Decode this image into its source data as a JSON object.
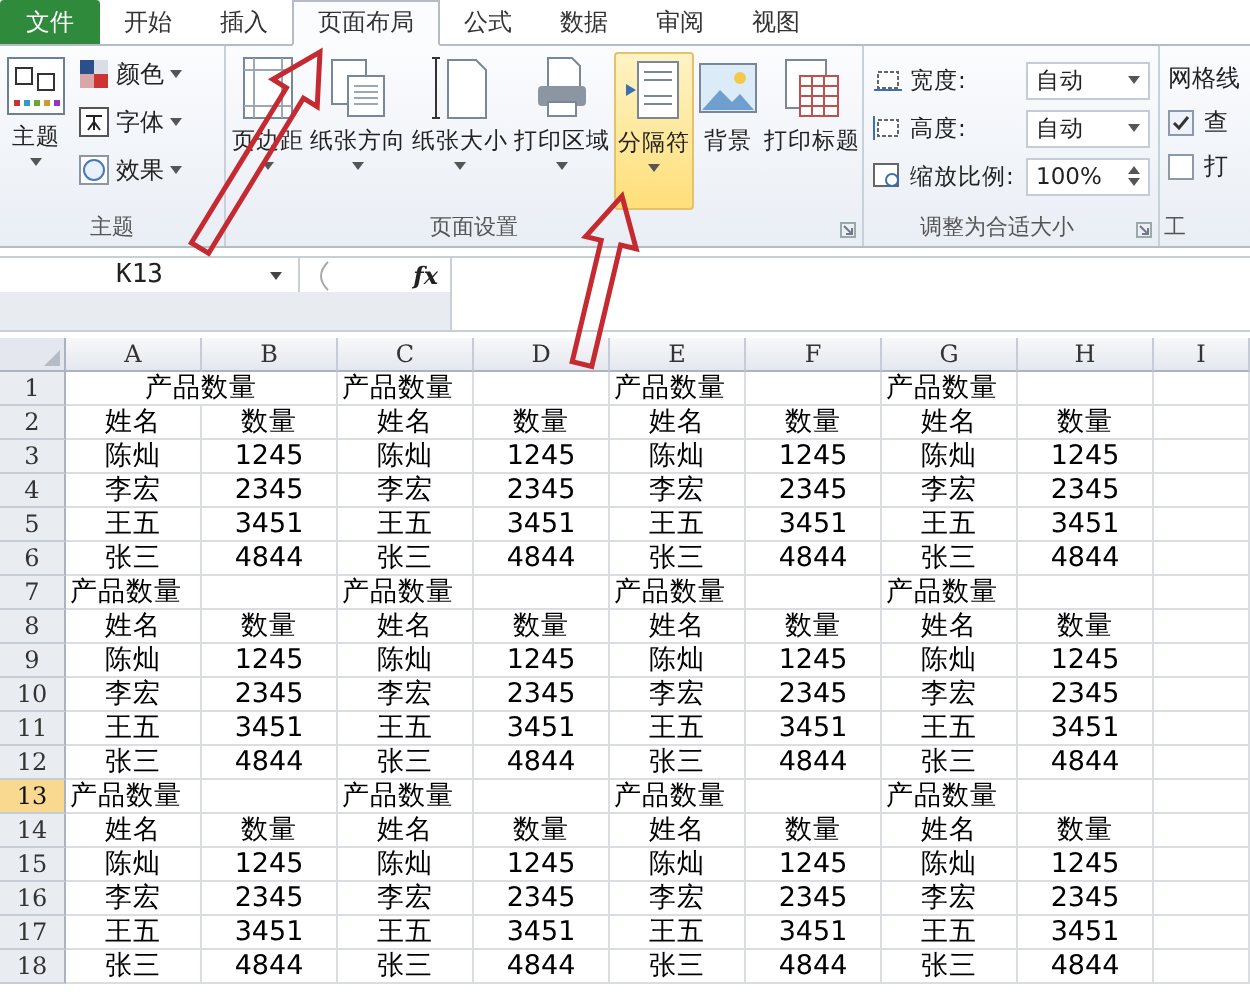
{
  "tabs": [
    {
      "label": "文件",
      "kind": "file",
      "selected": false
    },
    {
      "label": "开始",
      "kind": "tab",
      "selected": false
    },
    {
      "label": "插入",
      "kind": "tab",
      "selected": false
    },
    {
      "label": "页面布局",
      "kind": "tab",
      "selected": true
    },
    {
      "label": "公式",
      "kind": "tab",
      "selected": false
    },
    {
      "label": "数据",
      "kind": "tab",
      "selected": false
    },
    {
      "label": "审阅",
      "kind": "tab",
      "selected": false
    },
    {
      "label": "视图",
      "kind": "tab",
      "selected": false
    }
  ],
  "ribbon": {
    "groups": [
      {
        "kind": "theme",
        "label": "主题",
        "big": {
          "label": "主题"
        },
        "items": [
          {
            "label": "颜色"
          },
          {
            "label": "字体"
          },
          {
            "label": "效果"
          }
        ]
      },
      {
        "kind": "page-setup",
        "label": "页面设置",
        "buttons": [
          {
            "label": "页边距",
            "dropdown": true,
            "highlighted": false
          },
          {
            "label": "纸张方向",
            "dropdown": true,
            "highlighted": false
          },
          {
            "label": "纸张大小",
            "dropdown": true,
            "highlighted": false
          },
          {
            "label": "打印区域",
            "dropdown": true,
            "highlighted": false
          },
          {
            "label": "分隔符",
            "dropdown": true,
            "highlighted": true
          },
          {
            "label": "背景",
            "dropdown": false,
            "highlighted": false
          },
          {
            "label": "打印标题",
            "dropdown": false,
            "highlighted": false
          }
        ]
      },
      {
        "kind": "scale",
        "label": "调整为合适大小",
        "fields": [
          {
            "label": "宽度:",
            "value": "自动",
            "kind": "select"
          },
          {
            "label": "高度:",
            "value": "自动",
            "kind": "select"
          },
          {
            "label": "缩放比例:",
            "value": "100%",
            "kind": "spin"
          }
        ]
      },
      {
        "kind": "sheet-options",
        "label": "工",
        "title": "网格线",
        "options": [
          {
            "label": "查",
            "checked": true
          },
          {
            "label": "打",
            "checked": false
          }
        ]
      }
    ]
  },
  "formula_bar": {
    "name_box": "K13",
    "fx": "fx"
  },
  "sheet": {
    "columns": [
      "A",
      "B",
      "C",
      "D",
      "E",
      "F",
      "G",
      "H",
      "I"
    ],
    "rows": [
      {
        "num": "1",
        "selected": false,
        "cells": [
          {
            "kind": "merged-title",
            "text": "产品数量"
          },
          "",
          {
            "kind": "title",
            "text": "产品数量"
          },
          "",
          {
            "kind": "title",
            "text": "产品数量"
          },
          "",
          {
            "kind": "title",
            "text": "产品数量"
          },
          ""
        ]
      },
      {
        "num": "2",
        "selected": false,
        "cells": [
          {
            "kind": "value",
            "text": "姓名"
          },
          {
            "kind": "value",
            "text": "数量"
          },
          {
            "kind": "value",
            "text": "姓名"
          },
          {
            "kind": "value",
            "text": "数量"
          },
          {
            "kind": "value",
            "text": "姓名"
          },
          {
            "kind": "value",
            "text": "数量"
          },
          {
            "kind": "value",
            "text": "姓名"
          },
          {
            "kind": "value",
            "text": "数量"
          }
        ]
      },
      {
        "num": "3",
        "selected": false,
        "cells": [
          {
            "kind": "value",
            "text": "陈灿"
          },
          {
            "kind": "value",
            "text": "1245"
          },
          {
            "kind": "value",
            "text": "陈灿"
          },
          {
            "kind": "value",
            "text": "1245"
          },
          {
            "kind": "value",
            "text": "陈灿"
          },
          {
            "kind": "value",
            "text": "1245"
          },
          {
            "kind": "value",
            "text": "陈灿"
          },
          {
            "kind": "value",
            "text": "1245"
          }
        ]
      },
      {
        "num": "4",
        "selected": false,
        "cells": [
          {
            "kind": "value",
            "text": "李宏"
          },
          {
            "kind": "value",
            "text": "2345"
          },
          {
            "kind": "value",
            "text": "李宏"
          },
          {
            "kind": "value",
            "text": "2345"
          },
          {
            "kind": "value",
            "text": "李宏"
          },
          {
            "kind": "value",
            "text": "2345"
          },
          {
            "kind": "value",
            "text": "李宏"
          },
          {
            "kind": "value",
            "text": "2345"
          }
        ]
      },
      {
        "num": "5",
        "selected": false,
        "cells": [
          {
            "kind": "value",
            "text": "王五"
          },
          {
            "kind": "value",
            "text": "3451"
          },
          {
            "kind": "value",
            "text": "王五"
          },
          {
            "kind": "value",
            "text": "3451"
          },
          {
            "kind": "value",
            "text": "王五"
          },
          {
            "kind": "value",
            "text": "3451"
          },
          {
            "kind": "value",
            "text": "王五"
          },
          {
            "kind": "value",
            "text": "3451"
          }
        ]
      },
      {
        "num": "6",
        "selected": false,
        "cells": [
          {
            "kind": "value",
            "text": "张三"
          },
          {
            "kind": "value",
            "text": "4844"
          },
          {
            "kind": "value",
            "text": "张三"
          },
          {
            "kind": "value",
            "text": "4844"
          },
          {
            "kind": "value",
            "text": "张三"
          },
          {
            "kind": "value",
            "text": "4844"
          },
          {
            "kind": "value",
            "text": "张三"
          },
          {
            "kind": "value",
            "text": "4844"
          }
        ]
      },
      {
        "num": "7",
        "selected": false,
        "cells": [
          {
            "kind": "title",
            "text": "产品数量"
          },
          "",
          {
            "kind": "title",
            "text": "产品数量"
          },
          "",
          {
            "kind": "title",
            "text": "产品数量"
          },
          "",
          {
            "kind": "title",
            "text": "产品数量"
          },
          ""
        ]
      },
      {
        "num": "8",
        "selected": false,
        "cells": [
          {
            "kind": "value",
            "text": "姓名"
          },
          {
            "kind": "value",
            "text": "数量"
          },
          {
            "kind": "value",
            "text": "姓名"
          },
          {
            "kind": "value",
            "text": "数量"
          },
          {
            "kind": "value",
            "text": "姓名"
          },
          {
            "kind": "value",
            "text": "数量"
          },
          {
            "kind": "value",
            "text": "姓名"
          },
          {
            "kind": "value",
            "text": "数量"
          }
        ]
      },
      {
        "num": "9",
        "selected": false,
        "cells": [
          {
            "kind": "value",
            "text": "陈灿"
          },
          {
            "kind": "value",
            "text": "1245"
          },
          {
            "kind": "value",
            "text": "陈灿"
          },
          {
            "kind": "value",
            "text": "1245"
          },
          {
            "kind": "value",
            "text": "陈灿"
          },
          {
            "kind": "value",
            "text": "1245"
          },
          {
            "kind": "value",
            "text": "陈灿"
          },
          {
            "kind": "value",
            "text": "1245"
          }
        ]
      },
      {
        "num": "10",
        "selected": false,
        "cells": [
          {
            "kind": "value",
            "text": "李宏"
          },
          {
            "kind": "value",
            "text": "2345"
          },
          {
            "kind": "value",
            "text": "李宏"
          },
          {
            "kind": "value",
            "text": "2345"
          },
          {
            "kind": "value",
            "text": "李宏"
          },
          {
            "kind": "value",
            "text": "2345"
          },
          {
            "kind": "value",
            "text": "李宏"
          },
          {
            "kind": "value",
            "text": "2345"
          }
        ]
      },
      {
        "num": "11",
        "selected": false,
        "cells": [
          {
            "kind": "value",
            "text": "王五"
          },
          {
            "kind": "value",
            "text": "3451"
          },
          {
            "kind": "value",
            "text": "王五"
          },
          {
            "kind": "value",
            "text": "3451"
          },
          {
            "kind": "value",
            "text": "王五"
          },
          {
            "kind": "value",
            "text": "3451"
          },
          {
            "kind": "value",
            "text": "王五"
          },
          {
            "kind": "value",
            "text": "3451"
          }
        ]
      },
      {
        "num": "12",
        "selected": false,
        "cells": [
          {
            "kind": "value",
            "text": "张三"
          },
          {
            "kind": "value",
            "text": "4844"
          },
          {
            "kind": "value",
            "text": "张三"
          },
          {
            "kind": "value",
            "text": "4844"
          },
          {
            "kind": "value",
            "text": "张三"
          },
          {
            "kind": "value",
            "text": "4844"
          },
          {
            "kind": "value",
            "text": "张三"
          },
          {
            "kind": "value",
            "text": "4844"
          }
        ]
      },
      {
        "num": "13",
        "selected": true,
        "cells": [
          {
            "kind": "title",
            "text": "产品数量"
          },
          "",
          {
            "kind": "title",
            "text": "产品数量"
          },
          "",
          {
            "kind": "title",
            "text": "产品数量"
          },
          "",
          {
            "kind": "title",
            "text": "产品数量"
          },
          ""
        ]
      },
      {
        "num": "14",
        "selected": false,
        "cells": [
          {
            "kind": "value",
            "text": "姓名"
          },
          {
            "kind": "value",
            "text": "数量"
          },
          {
            "kind": "value",
            "text": "姓名"
          },
          {
            "kind": "value",
            "text": "数量"
          },
          {
            "kind": "value",
            "text": "姓名"
          },
          {
            "kind": "value",
            "text": "数量"
          },
          {
            "kind": "value",
            "text": "姓名"
          },
          {
            "kind": "value",
            "text": "数量"
          }
        ]
      },
      {
        "num": "15",
        "selected": false,
        "cells": [
          {
            "kind": "value",
            "text": "陈灿"
          },
          {
            "kind": "value",
            "text": "1245"
          },
          {
            "kind": "value",
            "text": "陈灿"
          },
          {
            "kind": "value",
            "text": "1245"
          },
          {
            "kind": "value",
            "text": "陈灿"
          },
          {
            "kind": "value",
            "text": "1245"
          },
          {
            "kind": "value",
            "text": "陈灿"
          },
          {
            "kind": "value",
            "text": "1245"
          }
        ]
      },
      {
        "num": "16",
        "selected": false,
        "cells": [
          {
            "kind": "value",
            "text": "李宏"
          },
          {
            "kind": "value",
            "text": "2345"
          },
          {
            "kind": "value",
            "text": "李宏"
          },
          {
            "kind": "value",
            "text": "2345"
          },
          {
            "kind": "value",
            "text": "李宏"
          },
          {
            "kind": "value",
            "text": "2345"
          },
          {
            "kind": "value",
            "text": "李宏"
          },
          {
            "kind": "value",
            "text": "2345"
          }
        ]
      },
      {
        "num": "17",
        "selected": false,
        "cells": [
          {
            "kind": "value",
            "text": "王五"
          },
          {
            "kind": "value",
            "text": "3451"
          },
          {
            "kind": "value",
            "text": "王五"
          },
          {
            "kind": "value",
            "text": "3451"
          },
          {
            "kind": "value",
            "text": "王五"
          },
          {
            "kind": "value",
            "text": "3451"
          },
          {
            "kind": "value",
            "text": "王五"
          },
          {
            "kind": "value",
            "text": "3451"
          }
        ]
      },
      {
        "num": "18",
        "selected": false,
        "cells": [
          {
            "kind": "value",
            "text": "张三"
          },
          {
            "kind": "value",
            "text": "4844"
          },
          {
            "kind": "value",
            "text": "张三"
          },
          {
            "kind": "value",
            "text": "4844"
          },
          {
            "kind": "value",
            "text": "张三"
          },
          {
            "kind": "value",
            "text": "4844"
          },
          {
            "kind": "value",
            "text": "张三"
          },
          {
            "kind": "value",
            "text": "4844"
          }
        ]
      }
    ]
  }
}
